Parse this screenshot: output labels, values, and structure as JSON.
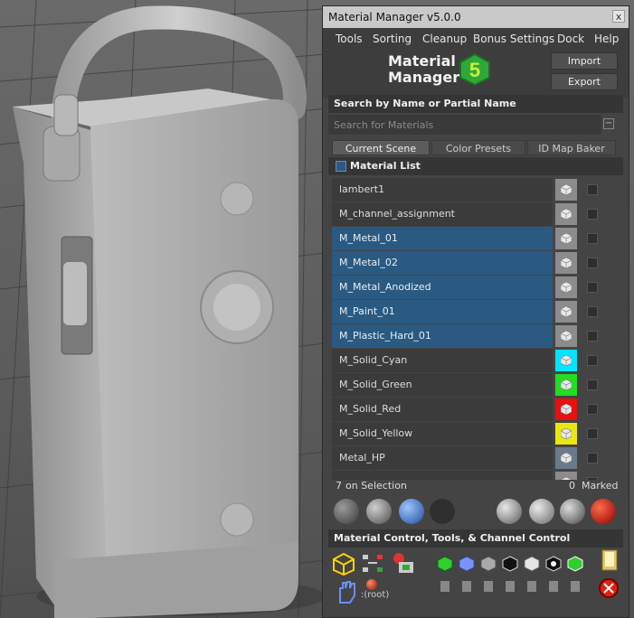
{
  "window": {
    "title": "Material Manager v5.0.0",
    "close_glyph": "x"
  },
  "menu": {
    "items": [
      "Tools",
      "Sorting",
      "Cleanup",
      "Bonus Settings",
      "Dock",
      "Help"
    ]
  },
  "logo": {
    "line1": "Material",
    "line2": "Manager",
    "badge_icon": "mm5-logo-icon"
  },
  "buttons": {
    "import": "Import",
    "export": "Export"
  },
  "search": {
    "header": "Search by Name or Partial Name",
    "placeholder": "Search for Materials",
    "value": ""
  },
  "tabs": [
    "Current Scene",
    "Color Presets",
    "ID Map Baker"
  ],
  "active_tab": "Current Scene",
  "material_list": {
    "header": "Material List",
    "items": [
      {
        "name": "lambert1",
        "selected": false,
        "swatch": "#8c8c8c"
      },
      {
        "name": "M_channel_assignment",
        "selected": false,
        "swatch": "#8c8c8c"
      },
      {
        "name": "M_Metal_01",
        "selected": true,
        "swatch": "#8c8c8c"
      },
      {
        "name": "M_Metal_02",
        "selected": true,
        "swatch": "#8c8c8c"
      },
      {
        "name": "M_Metal_Anodized",
        "selected": true,
        "swatch": "#8c8c8c"
      },
      {
        "name": "M_Paint_01",
        "selected": true,
        "swatch": "#8c8c8c"
      },
      {
        "name": "M_Plastic_Hard_01",
        "selected": true,
        "swatch": "#8c8c8c"
      },
      {
        "name": "M_Solid_Cyan",
        "selected": false,
        "swatch": "#00e5ff"
      },
      {
        "name": "M_Solid_Green",
        "selected": false,
        "swatch": "#22dd22"
      },
      {
        "name": "M_Solid_Red",
        "selected": false,
        "swatch": "#e81010"
      },
      {
        "name": "M_Solid_Yellow",
        "selected": false,
        "swatch": "#e8e810"
      },
      {
        "name": "Metal_HP",
        "selected": false,
        "swatch": "#6a7a8a"
      },
      {
        "name": "",
        "selected": false,
        "swatch": "#8c8c8c"
      }
    ]
  },
  "status": {
    "selection_count": "7",
    "selection_label": "on Selection",
    "marked_count": "0",
    "marked_label": "Marked"
  },
  "tool_icons": [
    "sphere-grey-icon",
    "sphere-light-icon",
    "sphere-blue-swirl-icon",
    "sphere-dark-icon",
    "sphere-refresh-icon",
    "magnifier-icon",
    "eyedropper-icon",
    "trash-red-icon"
  ],
  "control": {
    "header": "Material Control, Tools, & Channel Control",
    "root_label": ":(root)",
    "icons": [
      "cube-yellow-icon",
      "node-graph-icon",
      "material-assign-icon",
      "hand-icon",
      "root-dot-icon",
      "cube-green-icon",
      "cube-blue-icon",
      "cube-grey-icon",
      "cube-black-icon",
      "cube-white-icon",
      "channel-eye-icon",
      "cube-green-white-icon",
      "folder-icon",
      "delete-red-x-icon"
    ]
  },
  "colors": {
    "selected_row": "#2a5a82",
    "panel_bg": "#444444",
    "header_bg": "#353535"
  }
}
